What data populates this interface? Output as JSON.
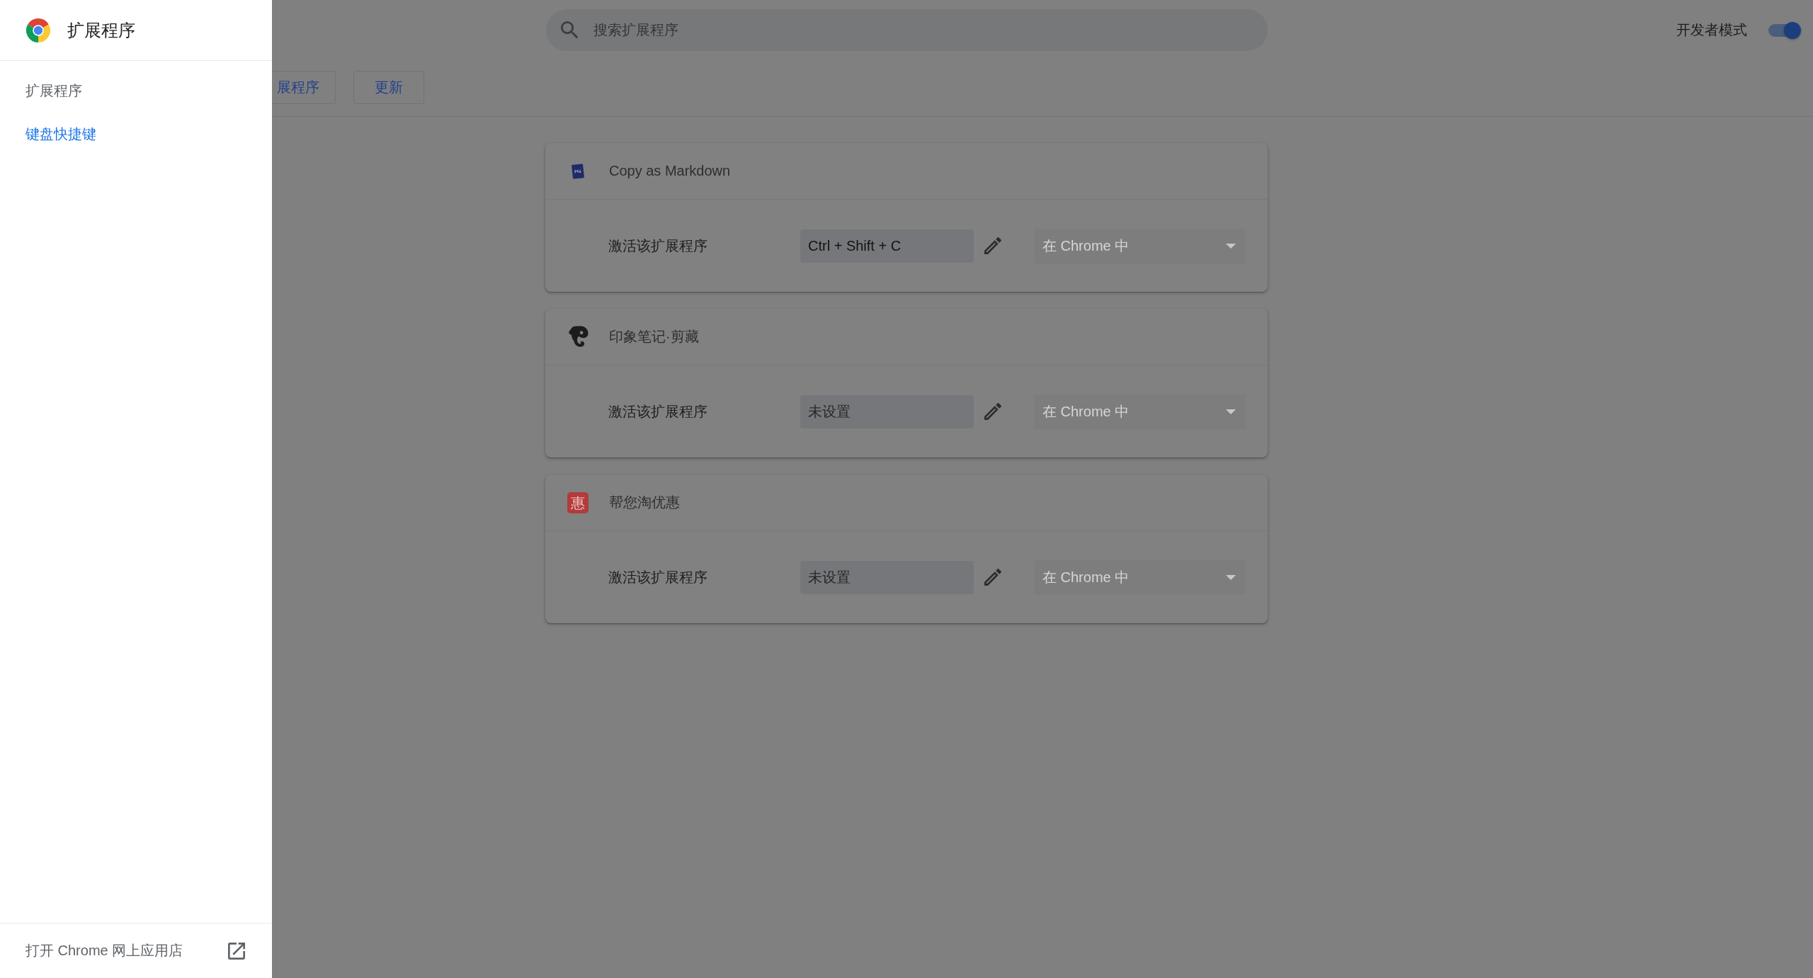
{
  "sidebar": {
    "title": "扩展程序",
    "items": [
      {
        "label": "扩展程序",
        "selected": false
      },
      {
        "label": "键盘快捷键",
        "selected": true
      }
    ],
    "footer_link": "打开 Chrome 网上应用店"
  },
  "header": {
    "search": {
      "placeholder": "搜索扩展程序"
    },
    "developer_mode": {
      "label": "开发者模式",
      "on": true
    },
    "buttons": [
      "展程序",
      "更新"
    ]
  },
  "extensions": [
    {
      "kind": "document",
      "name": "Copy as Markdown",
      "commands": [
        {
          "label": "激活该扩展程序",
          "value": "Ctrl + Shift + C",
          "scope": {
            "value": "在 Chrome 中",
            "disabled": true
          }
        }
      ]
    },
    {
      "kind": "elephant",
      "name": "印象笔记·剪藏",
      "commands": [
        {
          "label": "激活该扩展程序",
          "placeholder": "未设置",
          "scope": {
            "value": "在 Chrome 中",
            "disabled": true
          }
        }
      ]
    },
    {
      "kind": "glyph",
      "logo_text": "惠",
      "name": "帮您淘优惠",
      "commands": [
        {
          "label": "激活该扩展程序",
          "placeholder": "未设置",
          "scope": {
            "value": "在 Chrome 中",
            "disabled": true
          }
        }
      ]
    }
  ]
}
